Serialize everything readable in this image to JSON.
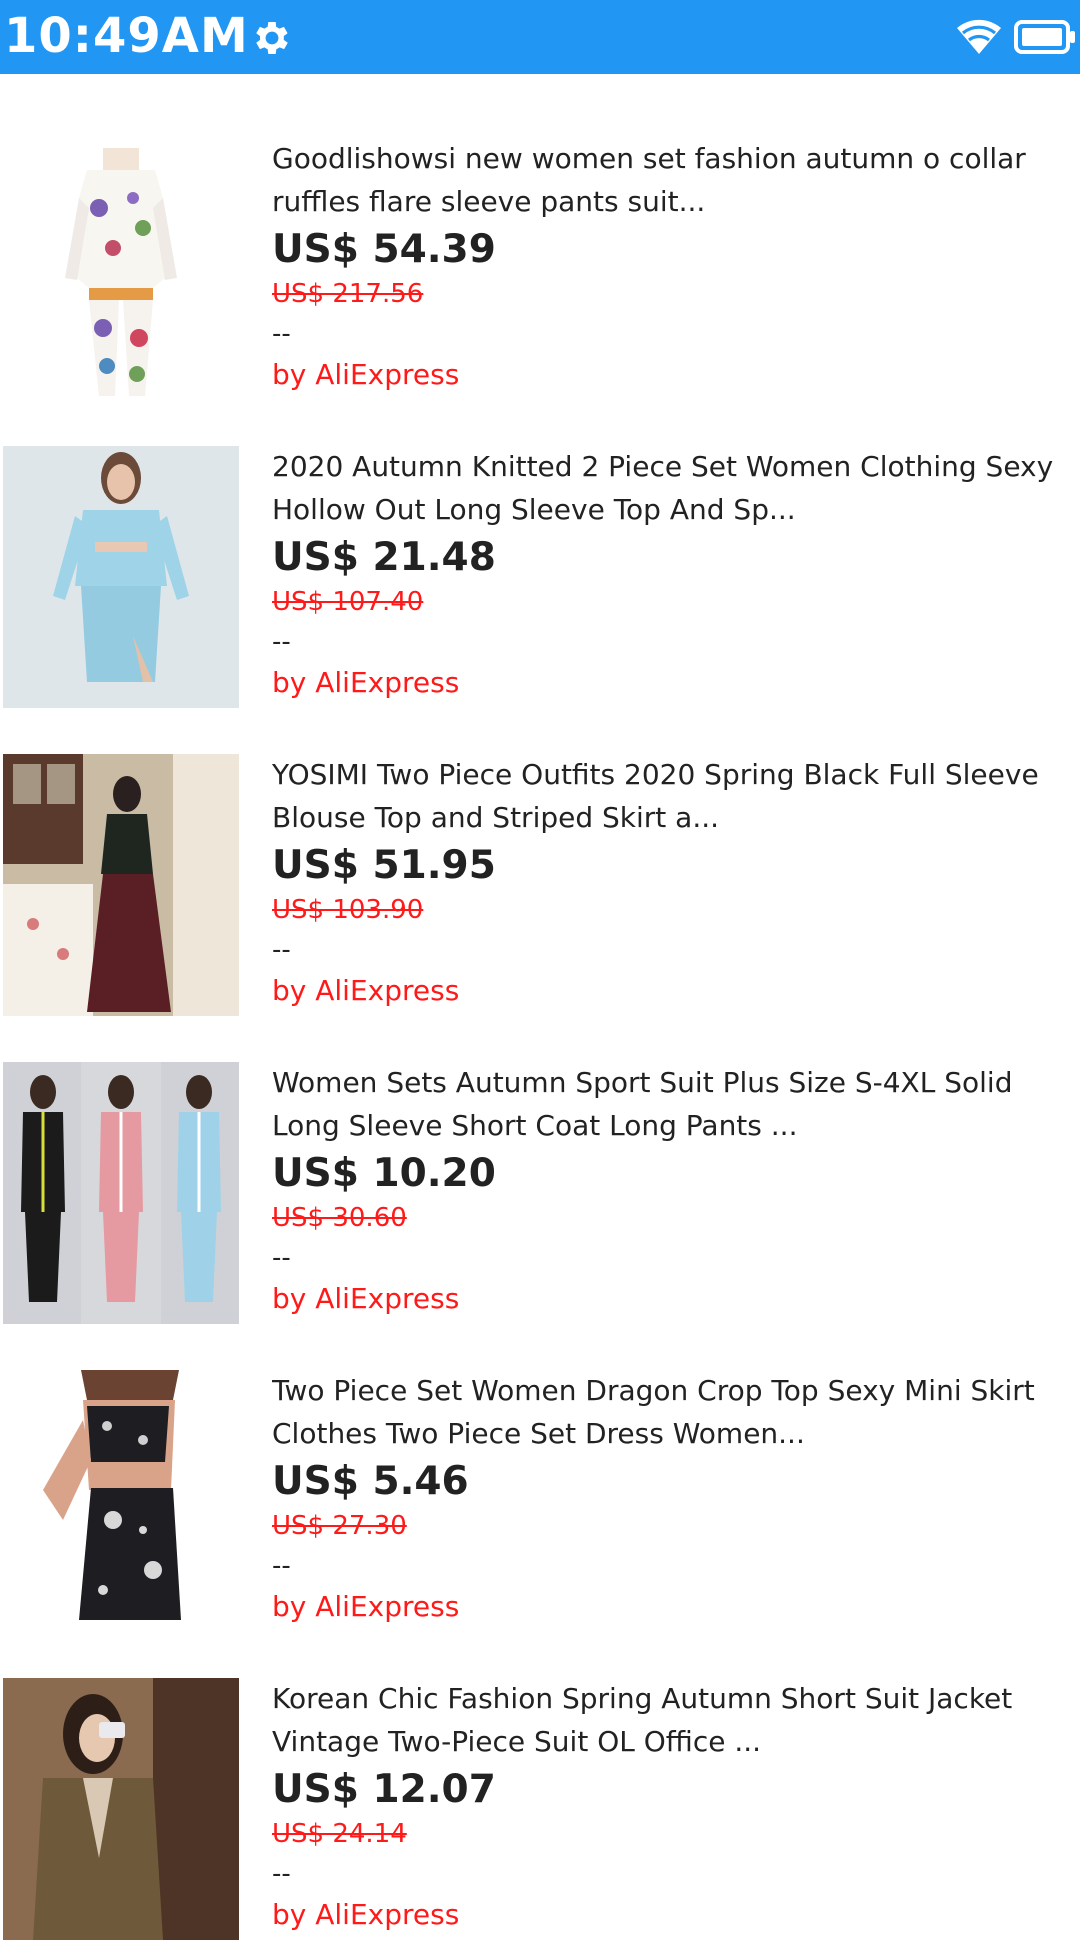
{
  "status": {
    "time": "10:49AM",
    "bar_color": "#2196F3"
  },
  "items": [
    {
      "title": "Goodlishowsi new women set fashion autumn o collar ruffles flare sleeve pants suit...",
      "price": "US$ 54.39",
      "old_price": "US$ 217.56",
      "rating": "--",
      "seller": "by AliExpress",
      "image": "floral-pants-suit-photo"
    },
    {
      "title": "2020 Autumn Knitted 2 Piece Set Women Clothing Sexy Hollow Out Long Sleeve Top And Sp...",
      "price": "US$ 21.48",
      "old_price": "US$ 107.40",
      "rating": "--",
      "seller": "by AliExpress",
      "image": "blue-knit-set-photo"
    },
    {
      "title": "YOSIMI Two Piece Outfits 2020 Spring Black Full Sleeve Blouse Top and Striped Skirt a...",
      "price": "US$ 51.95",
      "old_price": "US$ 103.90",
      "rating": "--",
      "seller": "by AliExpress",
      "image": "black-blouse-skirt-photo"
    },
    {
      "title": "Women Sets Autumn Sport Suit Plus Size S-4XL Solid Long Sleeve Short Coat Long Pants ...",
      "price": "US$ 10.20",
      "old_price": "US$ 30.60",
      "rating": "--",
      "seller": "by AliExpress",
      "image": "sport-suit-three-colors-photo"
    },
    {
      "title": "Two Piece Set Women Dragon Crop Top Sexy Mini Skirt Clothes Two Piece Set Dress Women...",
      "price": "US$ 5.46",
      "old_price": "US$ 27.30",
      "rating": "--",
      "seller": "by AliExpress",
      "image": "crop-top-mini-skirt-photo"
    },
    {
      "title": "Korean Chic Fashion Spring Autumn Short Suit Jacket Vintage Two-Piece Suit OL Office ...",
      "price": "US$ 12.07",
      "old_price": "US$ 24.14",
      "rating": "--",
      "seller": "by AliExpress",
      "image": "plaid-jacket-suit-photo"
    }
  ]
}
